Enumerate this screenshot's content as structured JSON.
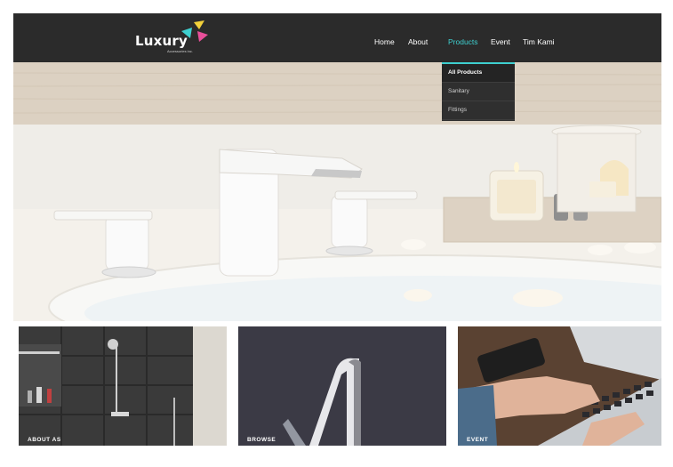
{
  "brand": {
    "name": "Luxury",
    "tagline": "Accessories inc."
  },
  "nav": {
    "items": [
      "Home",
      "About",
      "Products",
      "Event",
      "Tim Kami"
    ],
    "active": "Products"
  },
  "dropdown": {
    "items": [
      "All Products",
      "Sanitary",
      "Fittings"
    ],
    "current": "All Products"
  },
  "tiles": [
    {
      "label": "ABOUT AS"
    },
    {
      "label": "BROWSE"
    },
    {
      "label": "EVENT"
    }
  ],
  "colors": {
    "header_bg": "#2b2b2b",
    "accent": "#3ecfcf",
    "logo_yellow": "#f2d13a",
    "logo_teal": "#3ecfcf",
    "logo_pink": "#e84f9a"
  }
}
